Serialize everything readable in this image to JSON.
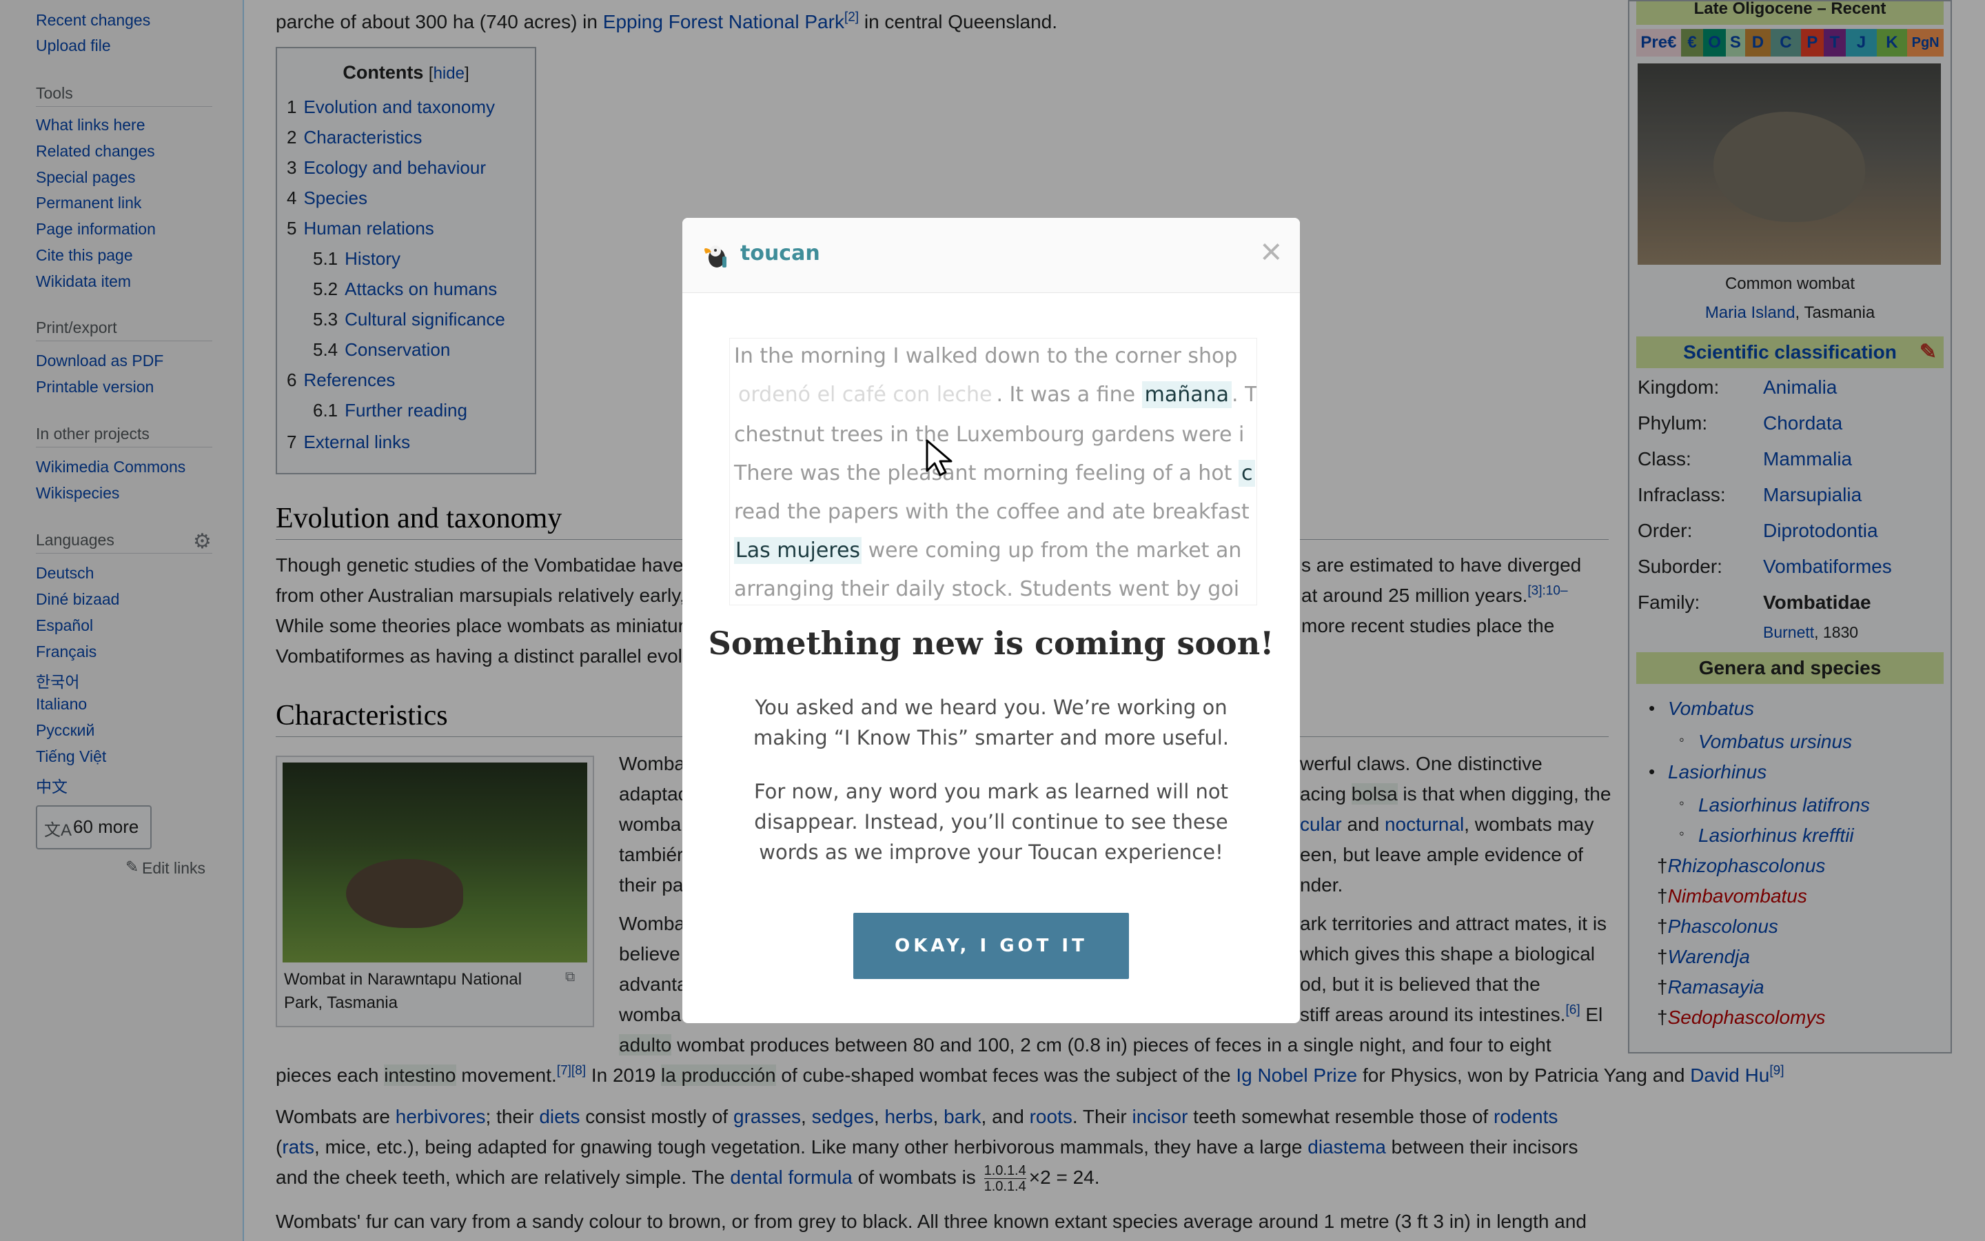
{
  "sidebar": {
    "links_top": [
      "Recent changes",
      "Upload file"
    ],
    "tools_heading": "Tools",
    "tools": [
      "What links here",
      "Related changes",
      "Special pages",
      "Permanent link",
      "Page information",
      "Cite this page",
      "Wikidata item"
    ],
    "print_heading": "Print/export",
    "print": [
      "Download as PDF",
      "Printable version"
    ],
    "projects_heading": "In other projects",
    "projects": [
      "Wikimedia Commons",
      "Wikispecies"
    ],
    "languages_heading": "Languages",
    "languages": [
      "Deutsch",
      "Diné bizaad",
      "Español",
      "Français",
      "한국어",
      "Italiano",
      "Русский",
      "Tiếng Việt",
      "中文"
    ],
    "more_languages": "60 more",
    "edit_links": "Edit links"
  },
  "article": {
    "intro_prefix": "parche of about 300 ha (740 acres) in ",
    "intro_link": "Epping Forest National Park",
    "intro_ref": "[2]",
    "intro_suffix": " in central Queensland.",
    "toc_title": "Contents",
    "toc_hide": "hide",
    "toc": [
      {
        "num": "1",
        "label": "Evolution and taxonomy"
      },
      {
        "num": "2",
        "label": "Characteristics"
      },
      {
        "num": "3",
        "label": "Ecology and behaviour"
      },
      {
        "num": "4",
        "label": "Species"
      },
      {
        "num": "5",
        "label": "Human relations"
      },
      {
        "num": "5.1",
        "label": "History"
      },
      {
        "num": "5.2",
        "label": "Attacks on humans"
      },
      {
        "num": "5.3",
        "label": "Cultural significance"
      },
      {
        "num": "5.4",
        "label": "Conservation"
      },
      {
        "num": "6",
        "label": "References"
      },
      {
        "num": "6.1",
        "label": "Further reading"
      },
      {
        "num": "7",
        "label": "External links"
      }
    ],
    "h_evolution": "Evolution and taxonomy",
    "evo_lines": [
      "Though genetic studies of the Vombatidae have",
      "from other Australian marsupials relatively early,",
      "While some theories place wombats as miniatur",
      "Vombatiformes as having a distinct parallel evol"
    ],
    "evo_right_lines": [
      "s are estimated to have diverged",
      "at around 25 million years.",
      "more recent studies place the"
    ],
    "evo_ref": "[3]:10–",
    "h_characteristics": "Characteristics",
    "image_caption": "Wombat in Narawntapu National Park, Tasmania",
    "char_left_words": [
      "Womba",
      "adaptac",
      "womba",
      "tambiér",
      "their pa",
      "Womba",
      "believe",
      "advanta",
      "womba"
    ],
    "char_right_parts": {
      "r1": "werful claws. One distinctive",
      "r2_a": "acing ",
      "r2_b": "bolsa",
      "r2_c": " is that when digging, the",
      "r3_link1": "cular",
      "r3_mid": " and ",
      "r3_link2": "nocturnal",
      "r3_end": ", wombats may",
      "r4": "een, but leave ample evidence of",
      "r5": "nder.",
      "r6": "ark territories and attract mates, it is",
      "r7": "which gives this shape a biological",
      "r8": "od, but it is believed that the",
      "r9": "stiff areas around its intestines.",
      "r9_ref": "[6]",
      "r9_end": " El"
    },
    "feces_line1_a": "adulto",
    "feces_line1_b": " wombat produces between 80 and 100, 2 cm (0.8 in) pieces of feces in a single night, and four to eight",
    "feces_line2_a": "pieces each ",
    "feces_line2_b": "intestino",
    "feces_line2_c": " movement.",
    "feces_line2_ref": "[7][8]",
    "feces_line2_d": " In 2019 ",
    "feces_line2_e": "la producción",
    "feces_line2_f": " of cube-shaped wombat feces was the subject of the ",
    "feces_line2_link": "Ig Nobel Prize",
    "feces_line2_g": " for Physics, won by Patricia Yang and ",
    "feces_line2_link2": "David Hu",
    "feces_line2_ref2": "[9]",
    "diet_1": "Wombats are ",
    "diet_links": [
      "herbivores",
      "diets",
      "grasses",
      "sedges",
      "herbs",
      "bark",
      "roots",
      "incisor",
      "rodents"
    ],
    "diet_line2": "rats",
    "diet_line2_b": ", mice, etc.), being adapted for gnawing tough vegetation. Like many other herbivorous mammals, they have a large ",
    "diet_line2_link": "diastema",
    "diet_line2_c": " between their incisors",
    "diet_line3_a": "and the cheek teeth, which are relatively simple. The ",
    "diet_line3_link": "dental formula",
    "diet_line3_b": " of wombats is",
    "formula_top": "1.0.1.4",
    "formula_bottom": "1.0.1.4",
    "formula_rest": "×2 = 24.",
    "fur_line": "Wombats' fur can vary from a sandy colour to brown, or from grey to black. All three known extant species average around 1 metre (3 ft 3 in) in length and"
  },
  "infobox": {
    "range": "Late Oligocene – Recent",
    "timeline": [
      "Pre€",
      "€",
      "O",
      "S",
      "D",
      "C",
      "P",
      "T",
      "J",
      "K",
      "PgN"
    ],
    "caption_title": "Common wombat",
    "caption_place_link": "Maria Island",
    "caption_place_rest": ", Tasmania",
    "sci_class": "Scientific classification",
    "rows": [
      {
        "label": "Kingdom:",
        "value": "Animalia"
      },
      {
        "label": "Phylum:",
        "value": "Chordata"
      },
      {
        "label": "Class:",
        "value": "Mammalia"
      },
      {
        "label": "Infraclass:",
        "value": "Marsupialia"
      },
      {
        "label": "Order:",
        "value": "Diprotodontia"
      },
      {
        "label": "Suborder:",
        "value": "Vombatiformes"
      },
      {
        "label": "Family:",
        "value": "Vombatidae"
      }
    ],
    "authority_link": "Burnett",
    "authority_year": ", 1830",
    "genera_heading": "Genera and species",
    "genera": [
      {
        "label": "Vombatus",
        "indent": 0,
        "dagger": "",
        "red": false
      },
      {
        "label": "Vombatus ursinus",
        "indent": 1,
        "dagger": "",
        "red": false
      },
      {
        "label": "Lasiorhinus",
        "indent": 0,
        "dagger": "",
        "red": false
      },
      {
        "label": "Lasiorhinus latifrons",
        "indent": 1,
        "dagger": "",
        "red": false
      },
      {
        "label": "Lasiorhinus krefftii",
        "indent": 1,
        "dagger": "",
        "red": false
      },
      {
        "label": "Rhizophascolonus",
        "indent": 0,
        "dagger": "†",
        "red": false
      },
      {
        "label": "Nimbavombatus",
        "indent": 0,
        "dagger": "†",
        "red": true
      },
      {
        "label": "Phascolonus",
        "indent": 0,
        "dagger": "†",
        "red": false
      },
      {
        "label": "Warendja",
        "indent": 0,
        "dagger": "†",
        "red": false
      },
      {
        "label": "Ramasayia",
        "indent": 0,
        "dagger": "†",
        "red": false
      },
      {
        "label": "Sedophascolomys",
        "indent": 0,
        "dagger": "†",
        "red": true
      }
    ]
  },
  "modal": {
    "brand": "toucan",
    "close_glyph": "×",
    "reader": {
      "l1": "In the morning I walked down to the corner shop",
      "l2_a": "ordenó el café con leche",
      "l2_b": ". It was a fine ",
      "l2_c": "mañana",
      "l2_d": ". T",
      "l3": "chestnut trees in the Luxembourg gardens were i",
      "l4_a": "There was the pleasant morning feeling of a hot ",
      "l4_b": "c",
      "l5": "read the papers with the coffee and ate breakfast",
      "l6_a": "Las mujeres",
      "l6_b": " were coming up from the market an",
      "l7": "arranging their daily stock. Students went by goi"
    },
    "title": "Something new is coming soon!",
    "para1": "You asked and we heard you. We’re working on making “I Know This” smarter and more useful.",
    "para2": "For now, any word you mark as learned will not disappear. Instead, you’ll continue to see these words as we improve your Toucan experience!",
    "button": "OKAY, I GOT IT",
    "colors": {
      "brand": "#3f8d99",
      "button": "#467d9a",
      "highlight": "#e6f3f5"
    }
  }
}
